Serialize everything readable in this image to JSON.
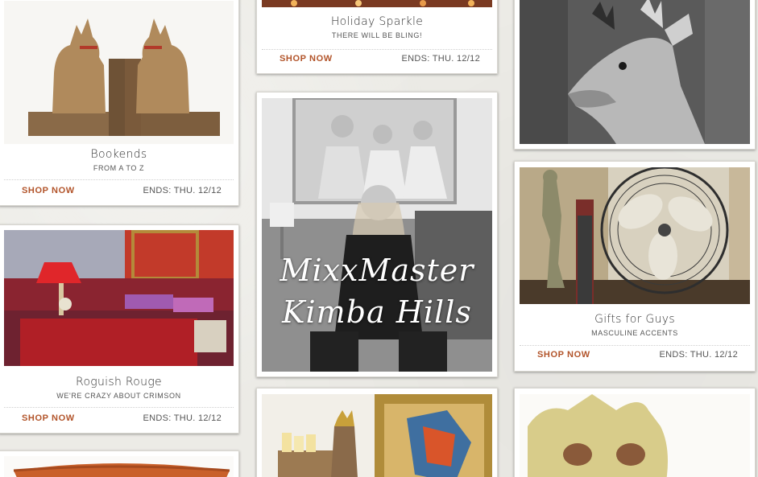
{
  "cards": {
    "bookends": {
      "title": "Bookends",
      "subtitle": "FROM A TO Z",
      "shop": "SHOP NOW",
      "ends": "ENDS: THU. 12/12"
    },
    "roguish": {
      "title": "Roguish Rouge",
      "subtitle": "WE'RE CRAZY ABOUT CRIMSON",
      "shop": "SHOP NOW",
      "ends": "ENDS: THU. 12/12"
    },
    "holiday": {
      "title": "Holiday Sparkle",
      "subtitle": "THERE WILL BE BLING!",
      "shop": "SHOP NOW",
      "ends": "ENDS: THU. 12/12"
    },
    "mixxmaster": {
      "line1": "MixxMaster",
      "line2": "Kimba Hills"
    },
    "gifts": {
      "title": "Gifts for Guys",
      "subtitle": "MASCULINE ACCENTS",
      "shop": "SHOP NOW",
      "ends": "ENDS: THU. 12/12"
    }
  },
  "colors": {
    "accent": "#b2542a",
    "background": "#ecebe6"
  }
}
